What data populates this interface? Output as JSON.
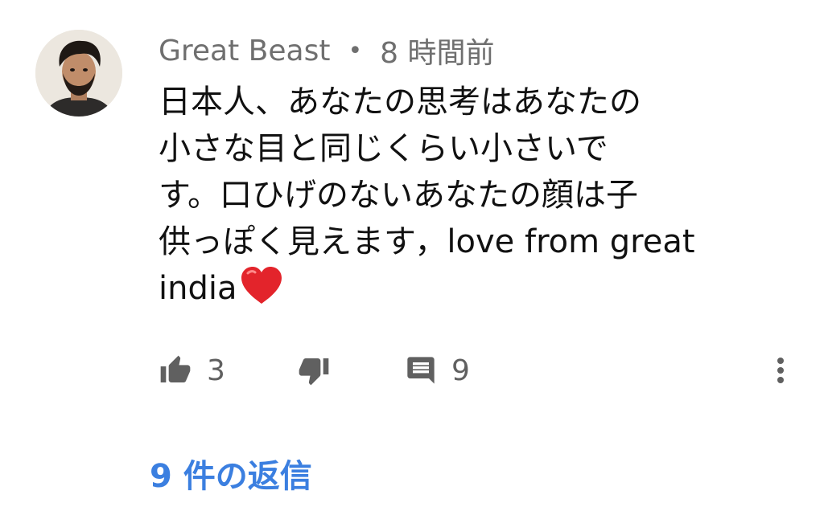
{
  "comment": {
    "author": "Great Beast",
    "separator": "•",
    "time": "8 時間前",
    "lines": [
      "日本人、あなたの思考はあなたの",
      "小さな目と同じくらい小さいで",
      "す。口ひげのないあなたの顔は子",
      "供っぽく見えます，love from great",
      "india"
    ],
    "emoji": "heart"
  },
  "actions": {
    "likes": "3",
    "replies_count": "9",
    "like_icon": "thumbs-up-icon",
    "dislike_icon": "thumbs-down-icon",
    "reply_icon": "comment-icon",
    "more_icon": "more-vertical-icon"
  },
  "replies_link": "9 件の返信",
  "colors": {
    "link": "#3b7fe0",
    "meta": "#6f6f6f",
    "heart": "#e3242b"
  }
}
